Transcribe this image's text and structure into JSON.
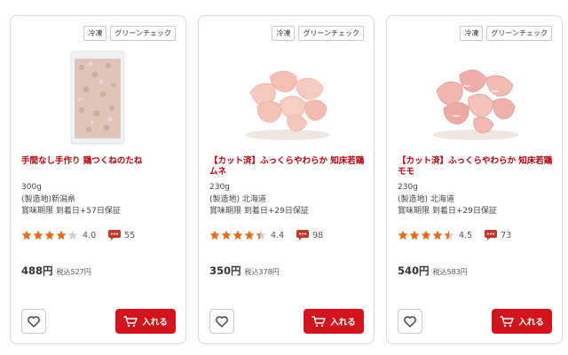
{
  "colors": {
    "accent": "#d2141e",
    "title": "#b3000e",
    "star": "#e36a1c",
    "border": "#d6d6d6"
  },
  "products": [
    {
      "tags": [
        "冷凍",
        "グリーンチェック"
      ],
      "title": "手間なし手作り 鶏つくねのたね",
      "weight": "300g",
      "origin": "(製造地)新潟県",
      "expiry": "賞味期限 到着日+57日保証",
      "rating": 4.0,
      "rating_text": "4.0",
      "reviews": "55",
      "price": "488円",
      "price_tax": "税込527円",
      "cart_label": "入れる",
      "image": "minced-chicken-pack"
    },
    {
      "tags": [
        "冷凍",
        "グリーンチェック"
      ],
      "title": "【カット済】ふっくらやわらか 知床若鶏 ムネ",
      "weight": "230g",
      "origin": "(製造地) 北海道",
      "expiry": "賞味期限 到着日+29日保証",
      "rating": 4.4,
      "rating_text": "4.4",
      "reviews": "98",
      "price": "350円",
      "price_tax": "税込378円",
      "cart_label": "入れる",
      "image": "chicken-breast-cut"
    },
    {
      "tags": [
        "冷凍",
        "グリーンチェック"
      ],
      "title": "【カット済】ふっくらやわらか 知床若鶏 モモ",
      "weight": "230g",
      "origin": "(製造地) 北海道",
      "expiry": "賞味期限 到着日+29日保証",
      "rating": 4.5,
      "rating_text": "4.5",
      "reviews": "73",
      "price": "540円",
      "price_tax": "税込583円",
      "cart_label": "入れる",
      "image": "chicken-thigh-cut"
    }
  ]
}
